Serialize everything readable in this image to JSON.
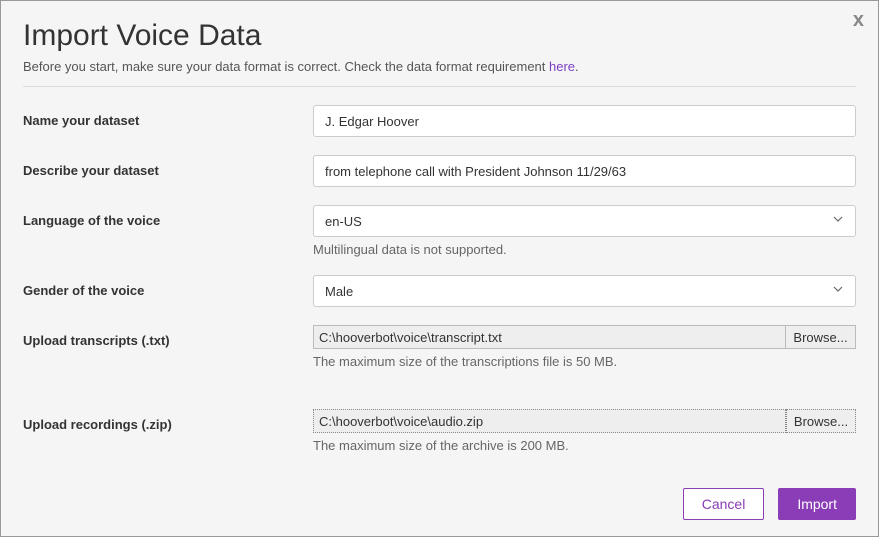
{
  "dialog": {
    "title": "Import Voice Data",
    "subtitle_pre": "Before you start, make sure your data format is correct. Check the data format requirement ",
    "subtitle_link": "here",
    "subtitle_post": ".",
    "close_label": "x"
  },
  "fields": {
    "name": {
      "label": "Name your dataset",
      "value": "J. Edgar Hoover"
    },
    "description": {
      "label": "Describe your dataset",
      "value": "from telephone call with President Johnson 11/29/63"
    },
    "language": {
      "label": "Language of the voice",
      "value": "en-US",
      "helper": "Multilingual data is not supported."
    },
    "gender": {
      "label": "Gender of the voice",
      "value": "Male"
    },
    "transcripts": {
      "label": "Upload transcripts (.txt)",
      "path": "C:\\hooverbot\\voice\\transcript.txt",
      "browse": "Browse...",
      "helper": "The maximum size of the transcriptions file is 50 MB."
    },
    "recordings": {
      "label": "Upload recordings (.zip)",
      "path": "C:\\hooverbot\\voice\\audio.zip",
      "browse": "Browse...",
      "helper": "The maximum size of the archive is 200 MB."
    }
  },
  "footer": {
    "cancel": "Cancel",
    "import": "Import"
  }
}
